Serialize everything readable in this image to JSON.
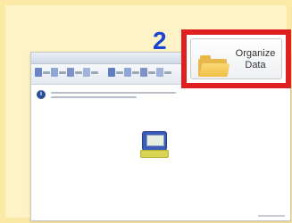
{
  "step": {
    "number": "2"
  },
  "button": {
    "line1": "Organize",
    "line2": "Data",
    "icon": "folder-icon"
  },
  "colors": {
    "step": "#1a44d4",
    "highlight": "#e02020",
    "background": "#fdf3c6"
  }
}
